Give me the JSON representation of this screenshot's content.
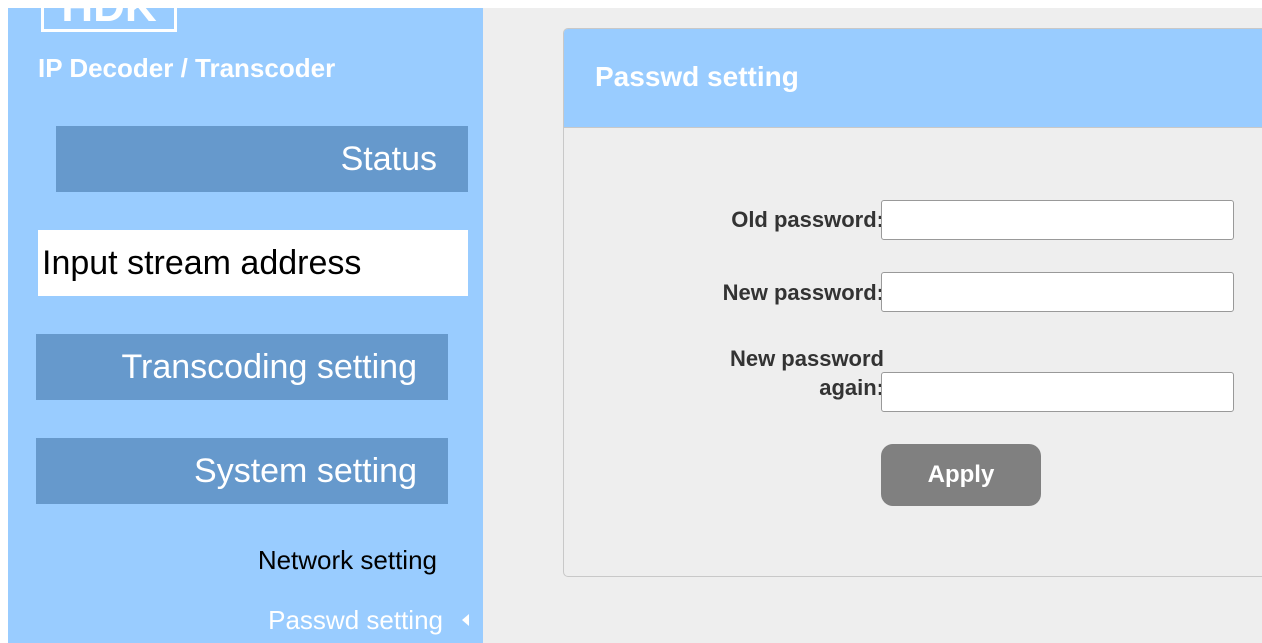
{
  "sidebar": {
    "logo_text": "HDK",
    "product_title": "IP Decoder / Transcoder",
    "nav": {
      "status": "Status",
      "input_stream_address": "Input stream address",
      "transcoding_setting": "Transcoding setting",
      "system_setting": "System setting"
    },
    "sub_nav": {
      "network_setting": "Network setting",
      "passwd_setting": "Passwd setting"
    }
  },
  "colors": {
    "sidebar_bg": "#99ccff",
    "nav_button_bg": "#6699cc",
    "active_nav_bg": "#ffffff",
    "panel_bg": "#eeeeee",
    "apply_button_bg": "#808080"
  },
  "icons": {
    "current_item_marker": "caret-left-icon"
  },
  "panel": {
    "title": "Passwd setting",
    "fields": {
      "old_password": {
        "label": "Old password:",
        "value": ""
      },
      "new_password": {
        "label": "New password:",
        "value": ""
      },
      "new_password_again": {
        "label_line1": "New password",
        "label_line2": "again:",
        "value": ""
      }
    },
    "apply_label": "Apply"
  }
}
